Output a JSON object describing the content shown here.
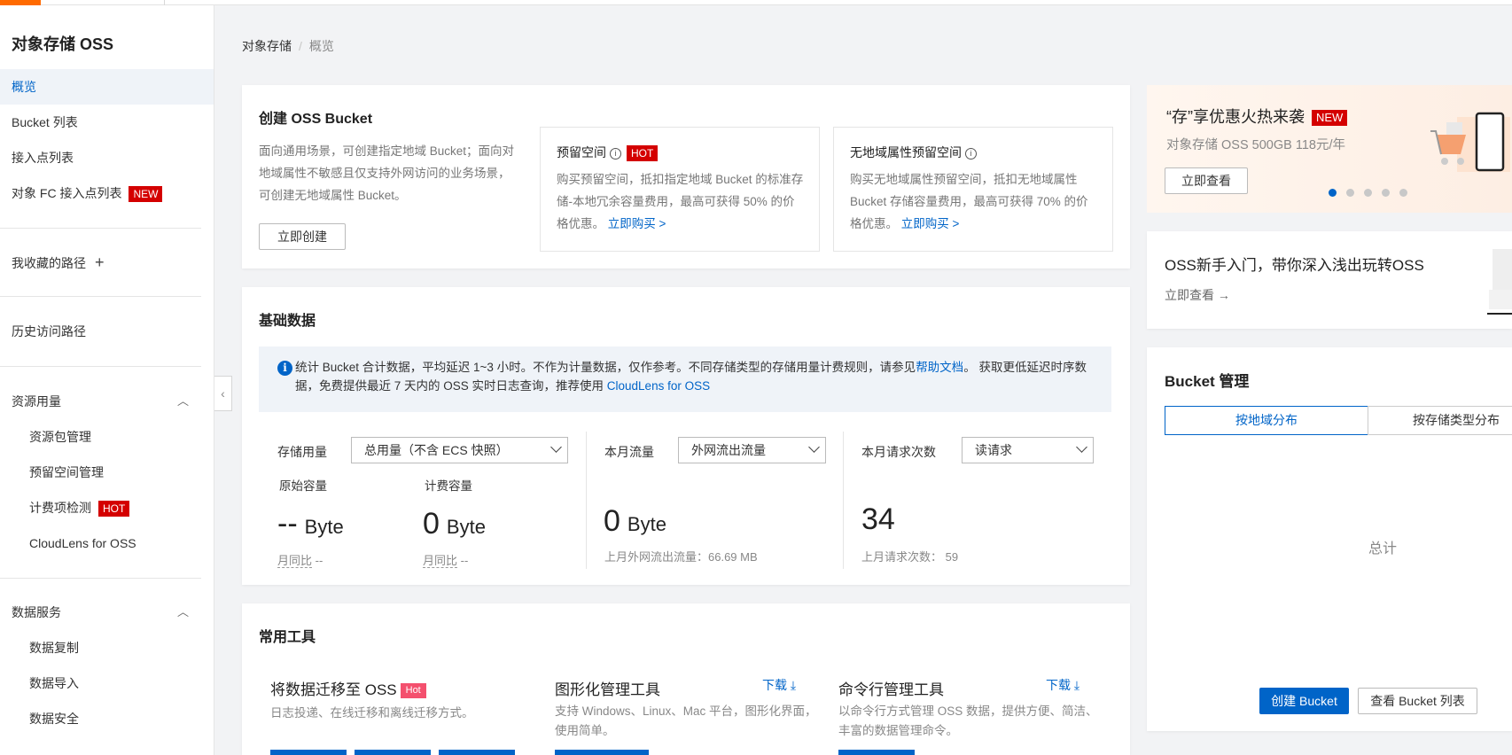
{
  "sidebar": {
    "title": "对象存储 OSS",
    "items": {
      "overview": "概览",
      "bucket_list": "Bucket 列表",
      "access_points": "接入点列表",
      "fc_access": "对象 FC 接入点列表",
      "fc_badge": "NEW",
      "favorites": "我收藏的路径",
      "history": "历史访问路径",
      "resource_usage": "资源用量",
      "pkg_mgmt": "资源包管理",
      "reserved_mgmt": "预留空间管理",
      "billing_check": "计费项检测",
      "billing_badge": "HOT",
      "cloudlens": "CloudLens for OSS",
      "data_services": "数据服务",
      "data_replication": "数据复制",
      "data_import": "数据导入",
      "data_security": "数据安全"
    }
  },
  "breadcrumb": {
    "root": "对象存储",
    "sep": "/",
    "current": "概览"
  },
  "create": {
    "title": "创建 OSS Bucket",
    "desc": "面向通用场景，可创建指定地域 Bucket；面向对地域属性不敏感且仅支持外网访问的业务场景，可创建无地域属性 Bucket。",
    "button": "立即创建",
    "reserved": {
      "title": "预留空间",
      "badge": "HOT",
      "desc": "购买预留空间，抵扣指定地域 Bucket 的标准存储-本地冗余容量费用，最高可获得 50% 的价格优惠。",
      "link": "立即购买 >"
    },
    "no_region": {
      "title": "无地域属性预留空间",
      "desc": "购买无地域属性预留空间，抵扣无地域属性 Bucket 存储容量费用，最高可获得 70% 的价格优惠。",
      "link": "立即购买 >"
    }
  },
  "basic": {
    "title": "基础数据",
    "notice_a": "统计 Bucket 合计数据，平均延迟 1~3 小时。不作为计量数据，仅作参考。不同存储类型的存储用量计费规则，请参见",
    "notice_link1": "帮助文档",
    "notice_b": "。 获取更低延迟时序数据，免费提供最近 7 天内的 OSS 实时日志查询，推荐使用 ",
    "notice_link2": "CloudLens for OSS",
    "storage_label": "存储用量",
    "storage_select": "总用量（不含 ECS 快照）",
    "raw_label": "原始容量",
    "raw_value": "--",
    "raw_unit": "Byte",
    "billed_label": "计费容量",
    "billed_value": "0",
    "billed_unit": "Byte",
    "mom_label": "月同比",
    "mom_value": "--",
    "traffic_label": "本月流量",
    "traffic_select": "外网流出流量",
    "traffic_value": "0",
    "traffic_unit": "Byte",
    "traffic_prev": "上月外网流出流量：66.69 MB",
    "req_label": "本月请求次数",
    "req_select": "读请求",
    "req_value": "34",
    "req_prev_label": "上月请求次数：",
    "req_prev_value": "59"
  },
  "tools": {
    "title": "常用工具",
    "migrate_title": "将数据迁移至 OSS",
    "migrate_badge": "Hot",
    "migrate_desc": "日志投递、在线迁移和离线迁移方式。",
    "gui_title": "图形化管理工具",
    "gui_desc": "支持 Windows、Linux、Mac 平台，图形化界面，使用简单。",
    "cli_title": "命令行管理工具",
    "cli_desc": "以命令行方式管理 OSS 数据，提供方便、简洁、丰富的数据管理命令。",
    "download": "下载"
  },
  "promo": {
    "title": "“存”享优惠火热来袭",
    "badge": "NEW",
    "subtitle": "对象存储 OSS 500GB 118元/年",
    "button": "立即查看",
    "slides": 5,
    "active_slide": 1
  },
  "guide": {
    "title": "OSS新手入门，带你深入浅出玩转OSS",
    "link": "立即查看"
  },
  "bucket_mgmt": {
    "title": "Bucket 管理",
    "tab_region": "按地域分布",
    "tab_type": "按存储类型分布",
    "total": "总计",
    "create_button": "创建 Bucket",
    "list_button": "查看 Bucket 列表"
  },
  "colors": {
    "accent": "#ff6a00",
    "primary": "#0064c8",
    "hot": "#d40000"
  }
}
